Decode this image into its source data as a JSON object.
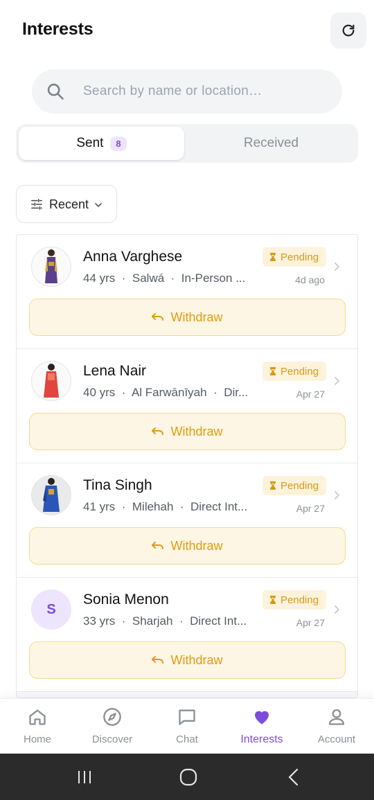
{
  "header": {
    "title": "Interests",
    "refresh_icon": "refresh-icon"
  },
  "search": {
    "placeholder": "Search by name or location…",
    "value": ""
  },
  "tabs": {
    "sent": {
      "label": "Sent",
      "count": "8",
      "active": true
    },
    "received": {
      "label": "Received",
      "active": false
    }
  },
  "sort": {
    "label": "Recent"
  },
  "interests": [
    {
      "name": "Anna Varghese",
      "age": "44 yrs",
      "location": "Salwá",
      "mode": "In-Person ...",
      "status": "Pending",
      "date": "4d ago",
      "action": "Withdraw",
      "avatar": "photo"
    },
    {
      "name": "Lena Nair",
      "age": "40 yrs",
      "location": "Al Farwānīyah",
      "mode": "Dir...",
      "status": "Pending",
      "date": "Apr 27",
      "action": "Withdraw",
      "avatar": "photo"
    },
    {
      "name": "Tina Singh",
      "age": "41 yrs",
      "location": "Milehah",
      "mode": "Direct Int...",
      "status": "Pending",
      "date": "Apr 27",
      "action": "Withdraw",
      "avatar": "photo"
    },
    {
      "name": "Sonia Menon",
      "age": "33 yrs",
      "location": "Sharjah",
      "mode": "Direct Int...",
      "status": "Pending",
      "date": "Apr 27",
      "action": "Withdraw",
      "avatar": "initial",
      "initial": "S"
    }
  ],
  "meta_separator": "·",
  "bottom_nav": [
    {
      "label": "Home",
      "icon": "home-icon",
      "active": false
    },
    {
      "label": "Discover",
      "icon": "compass-icon",
      "active": false
    },
    {
      "label": "Chat",
      "icon": "chat-icon",
      "active": false
    },
    {
      "label": "Interests",
      "icon": "heart-icon",
      "active": true
    },
    {
      "label": "Account",
      "icon": "user-icon",
      "active": false
    }
  ],
  "colors": {
    "accent": "#7c4ddb",
    "pending_bg": "#fdf3dc",
    "pending_text": "#d39a17",
    "withdraw_border": "#f6d98f",
    "withdraw_bg": "#fef6e4"
  }
}
